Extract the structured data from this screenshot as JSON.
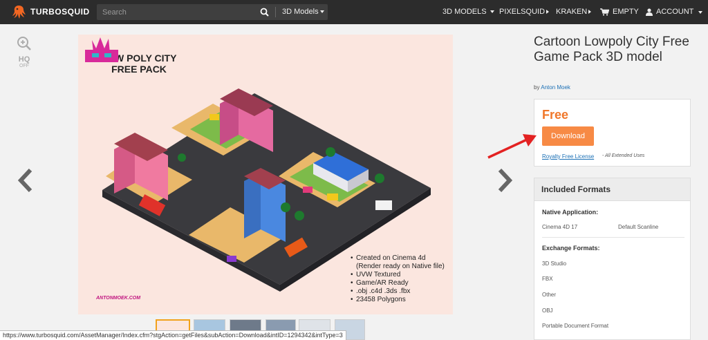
{
  "header": {
    "brand": "TURBOSQUID",
    "search_placeholder": "Search",
    "category": "3D Models",
    "nav": {
      "models": "3D MODELS",
      "pixelsquid": "PIXELSQUID",
      "kraken": "KRAKEN",
      "cart": "EMPTY",
      "account": "ACCOUNT"
    }
  },
  "viewer": {
    "hq_label": "HQ",
    "hq_state": "OFF",
    "image": {
      "title_line1": "LOW POLY CITY",
      "title_line2": "FREE PACK",
      "features": {
        "line1": "Created on Cinema 4d",
        "line2": "(Render ready on Native file)",
        "line3": "UVW Textured",
        "line4": "Game/AR Ready",
        "line5": ".obj .c4d .3ds .fbx",
        "line6": "23458 Polygons"
      },
      "author_mark": "ANTONMOEK.COM"
    }
  },
  "status_url": "https://www.turbosquid.com/AssetManager/Index.cfm?stgAction=getFiles&subAction=Download&intID=1294342&intType=3",
  "product": {
    "title": "Cartoon Lowpoly City Free Game Pack 3D model",
    "by": "by",
    "author": "Anton Moek",
    "price": "Free",
    "download_label": "Download",
    "license": "Royalty Free License",
    "license_note": "- All Extended Uses"
  },
  "formats": {
    "header": "Included Formats",
    "native_label": "Native Application:",
    "native_app": "Cinema 4D 17",
    "native_renderer": "Default Scanline",
    "exchange_label": "Exchange Formats:",
    "exchange": {
      "f1": "3D Studio",
      "f2": "FBX",
      "f3": "Other",
      "f4": "OBJ",
      "f5": "Portable Document Format"
    }
  },
  "colors": {
    "header_bg": "#2c2c2c",
    "accent_orange": "#f78a45",
    "price_orange": "#f0772a",
    "link_blue": "#1a6fb5",
    "annotation_red": "#e32222"
  }
}
